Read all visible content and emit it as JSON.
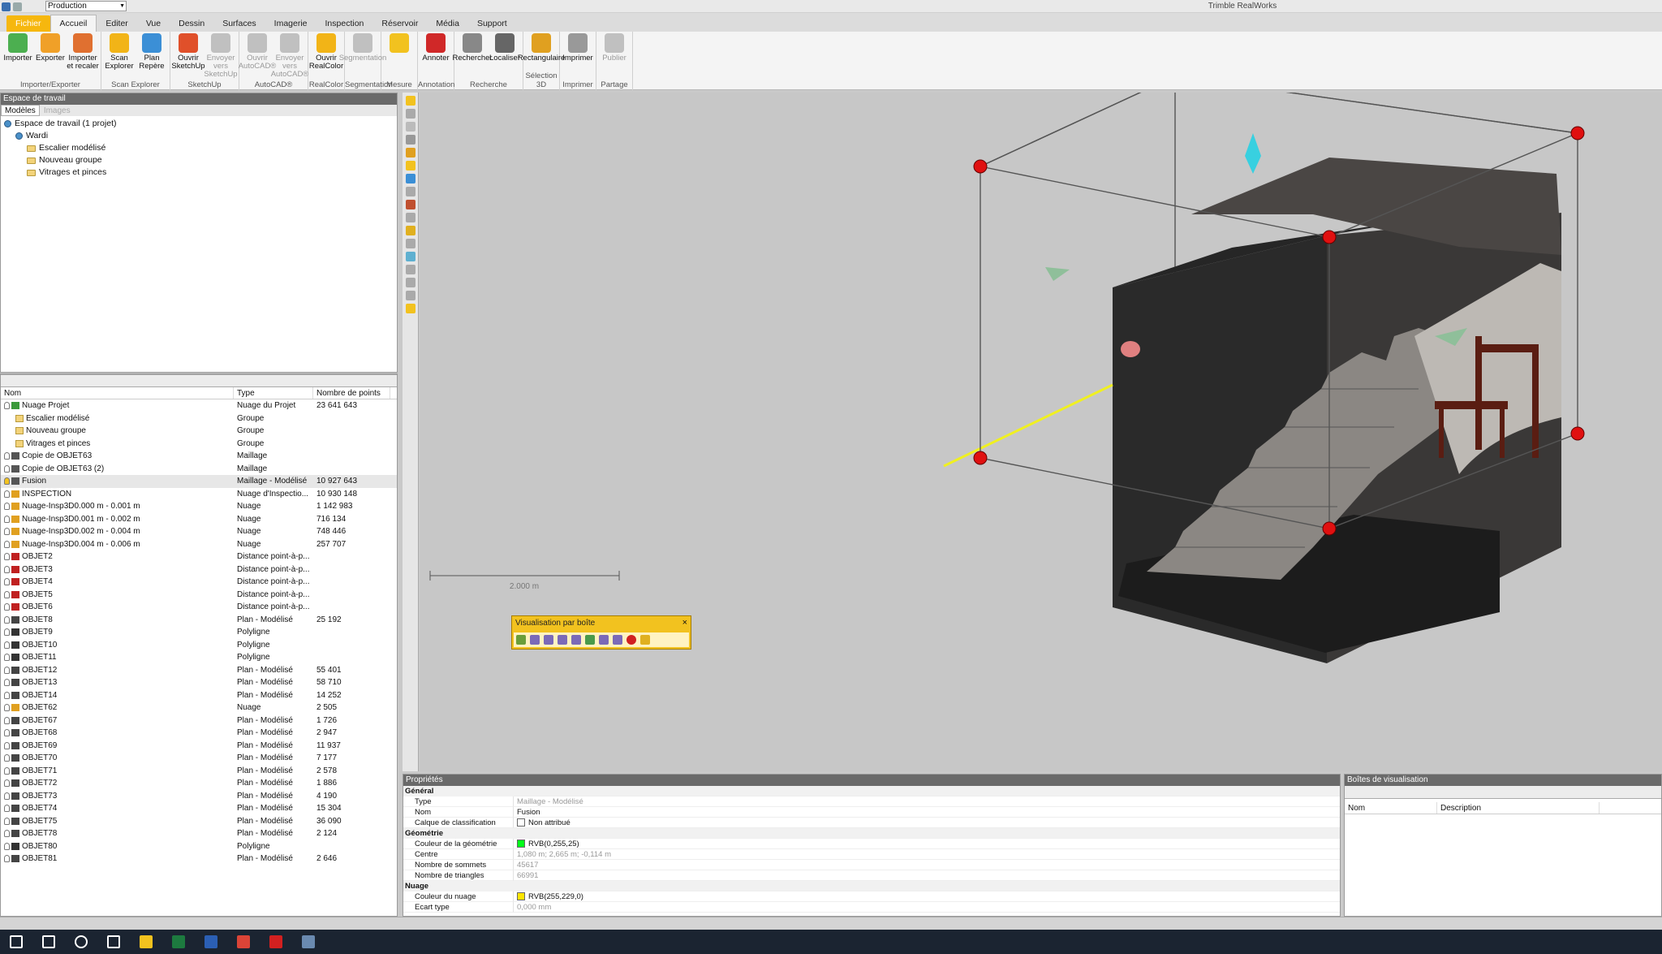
{
  "window": {
    "title": "Trimble RealWorks",
    "project_combo": "Production"
  },
  "menu": [
    {
      "label": "Fichier",
      "kind": "file"
    },
    {
      "label": "Accueil",
      "kind": "active"
    },
    {
      "label": "Editer",
      "kind": ""
    },
    {
      "label": "Vue",
      "kind": ""
    },
    {
      "label": "Dessin",
      "kind": ""
    },
    {
      "label": "Surfaces",
      "kind": ""
    },
    {
      "label": "Imagerie",
      "kind": ""
    },
    {
      "label": "Inspection",
      "kind": ""
    },
    {
      "label": "Réservoir",
      "kind": ""
    },
    {
      "label": "Média",
      "kind": ""
    },
    {
      "label": "Support",
      "kind": ""
    }
  ],
  "ribbon": [
    {
      "label": "Importer/Exporter",
      "buttons": [
        {
          "label": "Importer",
          "icon": "import-icon",
          "color": "#4caf50"
        },
        {
          "label": "Exporter",
          "icon": "export-icon",
          "color": "#f0a028"
        },
        {
          "label": "Importer et recaler",
          "icon": "import-register-icon",
          "color": "#e07030"
        }
      ]
    },
    {
      "label": "Scan Explorer",
      "buttons": [
        {
          "label": "Scan Explorer",
          "icon": "scan-explorer-icon",
          "color": "#f2b417"
        },
        {
          "label": "Plan Repère",
          "icon": "plan-icon",
          "color": "#3b8fd6"
        }
      ]
    },
    {
      "label": "SketchUp",
      "buttons": [
        {
          "label": "Ouvrir SketchUp",
          "icon": "sketchup-icon",
          "color": "#e0502a"
        },
        {
          "label": "Envoyer vers SketchUp",
          "icon": "send-sketchup-icon",
          "color": "#c0c0c0",
          "disabled": true
        }
      ]
    },
    {
      "label": "AutoCAD®",
      "buttons": [
        {
          "label": "Ouvrir AutoCAD®",
          "icon": "autocad-icon",
          "color": "#c0c0c0",
          "disabled": true
        },
        {
          "label": "Envoyer vers AutoCAD®",
          "icon": "send-autocad-icon",
          "color": "#c0c0c0",
          "disabled": true
        }
      ]
    },
    {
      "label": "RealColor",
      "buttons": [
        {
          "label": "Ouvrir RealColor",
          "icon": "realcolor-icon",
          "color": "#f2b417"
        }
      ]
    },
    {
      "label": "Segmentation",
      "buttons": [
        {
          "label": "Segmentation",
          "icon": "segmentation-icon",
          "color": "#c0c0c0",
          "disabled": true
        }
      ]
    },
    {
      "label": "Mesure",
      "buttons": [
        {
          "label": "",
          "icon": "measure-icon",
          "color": "#f2c21f"
        }
      ]
    },
    {
      "label": "Annotation",
      "buttons": [
        {
          "label": "Annoter",
          "icon": "annotate-icon",
          "color": "#d02828"
        }
      ]
    },
    {
      "label": "Recherche",
      "buttons": [
        {
          "label": "Rechercher",
          "icon": "search-icon",
          "color": "#888888"
        },
        {
          "label": "Localiser",
          "icon": "locate-icon",
          "color": "#666666"
        }
      ]
    },
    {
      "label": "Sélection 3D",
      "buttons": [
        {
          "label": "Rectangulaire",
          "icon": "rect-select-icon",
          "color": "#e0a020"
        }
      ]
    },
    {
      "label": "Imprimer",
      "buttons": [
        {
          "label": "Imprimer",
          "icon": "print-icon",
          "color": "#999999"
        }
      ]
    },
    {
      "label": "Partage",
      "buttons": [
        {
          "label": "Publier",
          "icon": "publish-icon",
          "color": "#c0c0c0",
          "disabled": true
        }
      ]
    }
  ],
  "workspace": {
    "title": "Espace de travail",
    "tabs": [
      "Modèles",
      "Images"
    ],
    "tree": [
      {
        "label": "Espace de travail (1 projet)",
        "level": 0,
        "icon": "workspace-icon"
      },
      {
        "label": "Wardi",
        "level": 1,
        "icon": "project-icon"
      },
      {
        "label": "Escalier modélisé",
        "level": 2,
        "icon": "folder-icon"
      },
      {
        "label": "Nouveau groupe",
        "level": 2,
        "icon": "folder-icon"
      },
      {
        "label": "Vitrages et pinces",
        "level": 2,
        "icon": "folder-icon"
      }
    ]
  },
  "list": {
    "headers": [
      "Nom",
      "Type",
      "Nombre de points"
    ],
    "rows": [
      {
        "name": "Nuage Projet",
        "type": "Nuage du Projet",
        "points": "23 641 643",
        "icon": "cloud-project-icon",
        "indent": 0
      },
      {
        "name": "Escalier modélisé",
        "type": "Groupe",
        "points": "",
        "icon": "folder-icon",
        "indent": 1
      },
      {
        "name": "Nouveau groupe",
        "type": "Groupe",
        "points": "",
        "icon": "folder-icon",
        "indent": 1
      },
      {
        "name": "Vitrages et pinces",
        "type": "Groupe",
        "points": "",
        "icon": "folder-icon",
        "indent": 1
      },
      {
        "name": "Copie de OBJET63",
        "type": "Maillage",
        "points": "",
        "icon": "mesh-icon",
        "indent": 0
      },
      {
        "name": "Copie de OBJET63 (2)",
        "type": "Maillage",
        "points": "",
        "icon": "mesh-icon",
        "indent": 0
      },
      {
        "name": "Fusion",
        "type": "Maillage - Modélisé",
        "points": "10 927 643",
        "icon": "mesh-icon",
        "indent": 0,
        "selected": true
      },
      {
        "name": "INSPECTION",
        "type": "Nuage d'Inspectio...",
        "points": "10 930 148",
        "icon": "cloud-icon",
        "indent": 0
      },
      {
        "name": "Nuage-Insp3D0.000 m - 0.001 m",
        "type": "Nuage",
        "points": "1 142 983",
        "icon": "cloud-icon",
        "indent": 0
      },
      {
        "name": "Nuage-Insp3D0.001 m - 0.002 m",
        "type": "Nuage",
        "points": "716 134",
        "icon": "cloud-icon",
        "indent": 0
      },
      {
        "name": "Nuage-Insp3D0.002 m - 0.004 m",
        "type": "Nuage",
        "points": "748 446",
        "icon": "cloud-icon",
        "indent": 0
      },
      {
        "name": "Nuage-Insp3D0.004 m - 0.006 m",
        "type": "Nuage",
        "points": "257 707",
        "icon": "cloud-icon",
        "indent": 0
      },
      {
        "name": "OBJET2",
        "type": "Distance point-à-p...",
        "points": "",
        "icon": "distance-icon",
        "indent": 0
      },
      {
        "name": "OBJET3",
        "type": "Distance point-à-p...",
        "points": "",
        "icon": "distance-icon",
        "indent": 0
      },
      {
        "name": "OBJET4",
        "type": "Distance point-à-p...",
        "points": "",
        "icon": "distance-icon",
        "indent": 0
      },
      {
        "name": "OBJET5",
        "type": "Distance point-à-p...",
        "points": "",
        "icon": "distance-icon",
        "indent": 0
      },
      {
        "name": "OBJET6",
        "type": "Distance point-à-p...",
        "points": "",
        "icon": "distance-icon",
        "indent": 0
      },
      {
        "name": "OBJET8",
        "type": "Plan - Modélisé",
        "points": "25 192",
        "icon": "plane-icon",
        "indent": 0
      },
      {
        "name": "OBJET9",
        "type": "Polyligne",
        "points": "",
        "icon": "polyline-icon",
        "indent": 0
      },
      {
        "name": "OBJET10",
        "type": "Polyligne",
        "points": "",
        "icon": "polyline-icon",
        "indent": 0
      },
      {
        "name": "OBJET11",
        "type": "Polyligne",
        "points": "",
        "icon": "polyline-icon",
        "indent": 0
      },
      {
        "name": "OBJET12",
        "type": "Plan - Modélisé",
        "points": "55 401",
        "icon": "plane-icon",
        "indent": 0
      },
      {
        "name": "OBJET13",
        "type": "Plan - Modélisé",
        "points": "58 710",
        "icon": "plane-icon",
        "indent": 0
      },
      {
        "name": "OBJET14",
        "type": "Plan - Modélisé",
        "points": "14 252",
        "icon": "plane-icon",
        "indent": 0
      },
      {
        "name": "OBJET62",
        "type": "Nuage",
        "points": "2 505",
        "icon": "cloud-icon",
        "indent": 0
      },
      {
        "name": "OBJET67",
        "type": "Plan - Modélisé",
        "points": "1 726",
        "icon": "plane-icon",
        "indent": 0
      },
      {
        "name": "OBJET68",
        "type": "Plan - Modélisé",
        "points": "2 947",
        "icon": "plane-icon",
        "indent": 0
      },
      {
        "name": "OBJET69",
        "type": "Plan - Modélisé",
        "points": "11 937",
        "icon": "plane-icon",
        "indent": 0
      },
      {
        "name": "OBJET70",
        "type": "Plan - Modélisé",
        "points": "7 177",
        "icon": "plane-icon",
        "indent": 0
      },
      {
        "name": "OBJET71",
        "type": "Plan - Modélisé",
        "points": "2 578",
        "icon": "plane-icon",
        "indent": 0
      },
      {
        "name": "OBJET72",
        "type": "Plan - Modélisé",
        "points": "1 886",
        "icon": "plane-icon",
        "indent": 0
      },
      {
        "name": "OBJET73",
        "type": "Plan - Modélisé",
        "points": "4 190",
        "icon": "plane-icon",
        "indent": 0
      },
      {
        "name": "OBJET74",
        "type": "Plan - Modélisé",
        "points": "15 304",
        "icon": "plane-icon",
        "indent": 0
      },
      {
        "name": "OBJET75",
        "type": "Plan - Modélisé",
        "points": "36 090",
        "icon": "plane-icon",
        "indent": 0
      },
      {
        "name": "OBJET78",
        "type": "Plan - Modélisé",
        "points": "2 124",
        "icon": "plane-icon",
        "indent": 0
      },
      {
        "name": "OBJET80",
        "type": "Polyligne",
        "points": "",
        "icon": "polyline-icon",
        "indent": 0
      },
      {
        "name": "OBJET81",
        "type": "Plan - Modélisé",
        "points": "2 646",
        "icon": "plane-icon",
        "indent": 0
      }
    ]
  },
  "viewport": {
    "floating_toolbar": {
      "title": "Visualisation par boîte",
      "close": "×"
    },
    "scale_label": "2.000 m",
    "box_color": "#e01010",
    "limit_line_color": "#f0f020"
  },
  "properties": {
    "title": "Propriétés",
    "rows": [
      {
        "kind": "cat",
        "key": "Général"
      },
      {
        "key": "Type",
        "value": "Maillage - Modélisé",
        "dim": true
      },
      {
        "key": "Nom",
        "value": "Fusion"
      },
      {
        "key": "Calque de classification",
        "value": "Non attribué",
        "swatch": "#ffffff"
      },
      {
        "kind": "cat",
        "key": "Géométrie"
      },
      {
        "key": "Couleur de la géométrie",
        "value": "RVB(0,255,25)",
        "swatch": "#00ff19"
      },
      {
        "key": "Centre",
        "value": "1,080 m; 2,665 m; -0,114 m",
        "dim": true
      },
      {
        "key": "Nombre de sommets",
        "value": "45617",
        "dim": true
      },
      {
        "key": "Nombre de triangles",
        "value": "66991",
        "dim": true
      },
      {
        "kind": "cat",
        "key": "Nuage"
      },
      {
        "key": "Couleur du nuage",
        "value": "RVB(255,229,0)",
        "swatch": "#ffe500"
      },
      {
        "key": "Ecart type",
        "value": "0,000 mm",
        "dim": true
      }
    ]
  },
  "boxes_panel": {
    "title": "Boîtes de visualisation",
    "headers": [
      "Nom",
      "Description"
    ]
  },
  "taskbar": [
    {
      "name": "start-icon",
      "color": "#ffffff"
    },
    {
      "name": "search-icon",
      "color": "#ffffff"
    },
    {
      "name": "cortana-icon",
      "color": "#ffffff"
    },
    {
      "name": "task-view-icon",
      "color": "#ffffff"
    },
    {
      "name": "file-explorer-icon",
      "color": "#f2c21f"
    },
    {
      "name": "excel-icon",
      "color": "#1d7a3f"
    },
    {
      "name": "word-icon",
      "color": "#2b5fb4"
    },
    {
      "name": "chrome-icon",
      "color": "#db4437"
    },
    {
      "name": "acrobat-icon",
      "color": "#d32020"
    },
    {
      "name": "realworks-icon",
      "color": "#6a8ab0"
    }
  ]
}
